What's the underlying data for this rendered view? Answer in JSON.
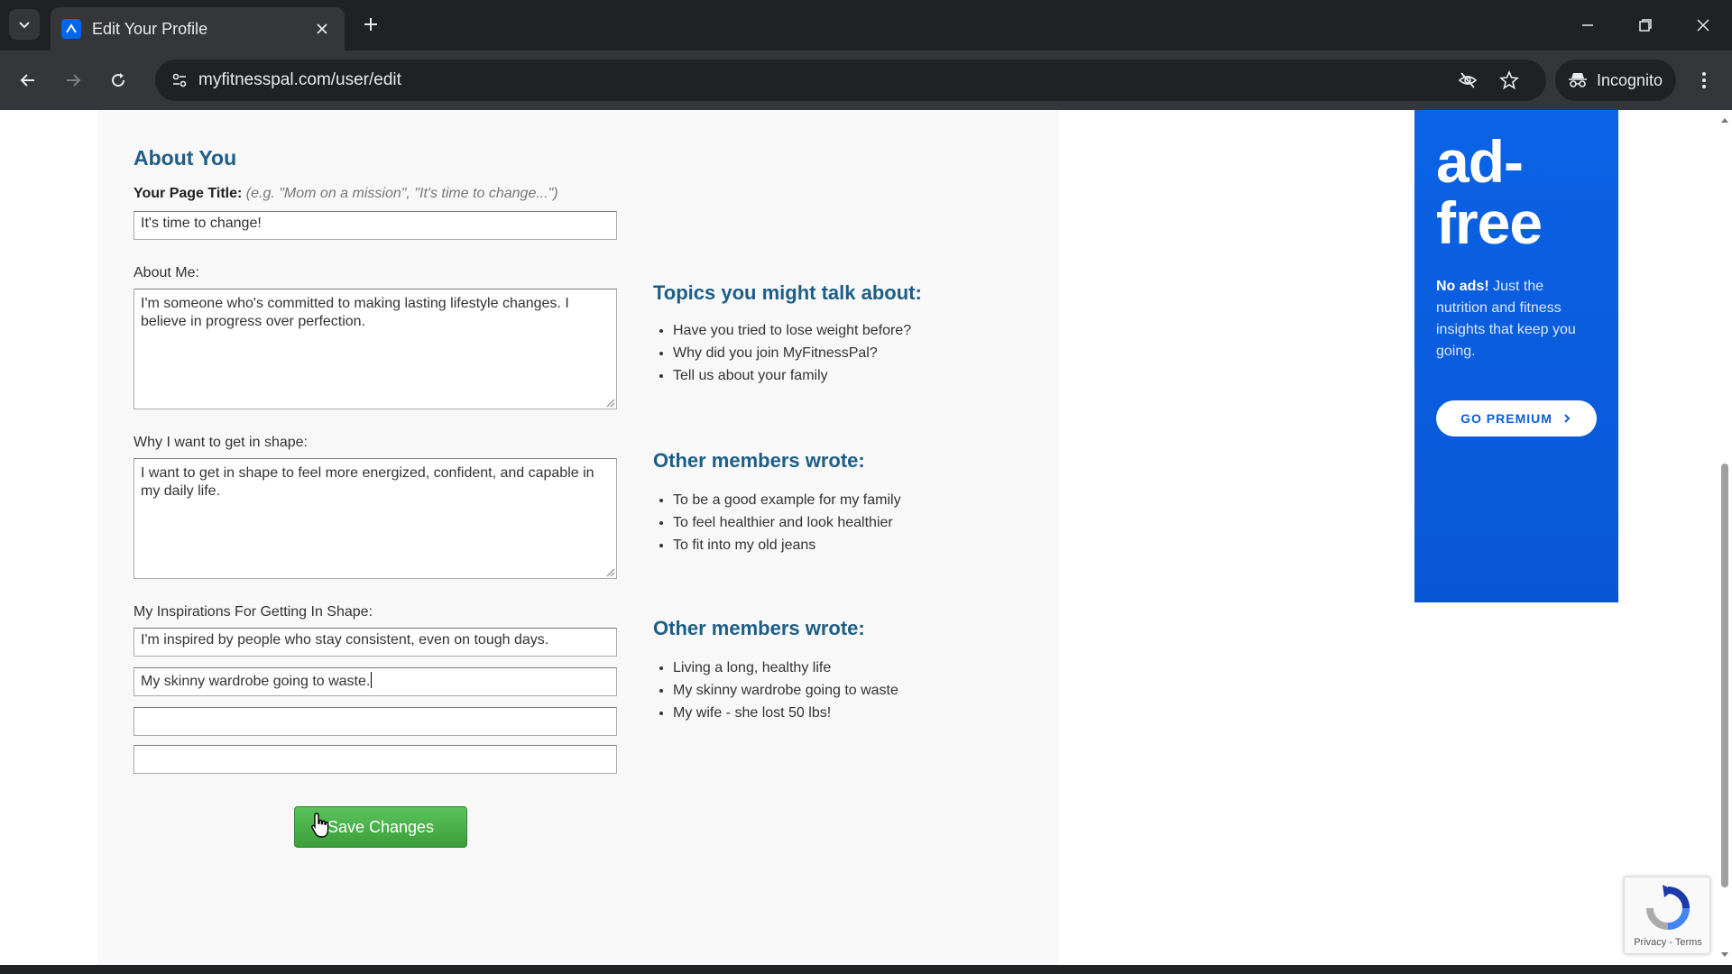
{
  "browser": {
    "tab_title": "Edit Your Profile",
    "url": "myfitnesspal.com/user/edit",
    "incognito_label": "Incognito"
  },
  "form": {
    "section_title": "About You",
    "page_title": {
      "label": "Your Page Title:",
      "hint": "(e.g. \"Mom on a mission\", \"It's time to change...\")",
      "value": "It's time to change!"
    },
    "about_me": {
      "label": "About Me:",
      "value": "I'm someone who's committed to making lasting lifestyle changes. I believe in progress over perfection."
    },
    "why_shape": {
      "label": "Why I want to get in shape:",
      "value": "I want to get in shape to feel more energized, confident, and capable in my daily life."
    },
    "inspirations": {
      "label": "My Inspirations For Getting In Shape:",
      "values": [
        "I'm inspired by people who stay consistent, even on tough days.",
        "My skinny wardrobe going to waste.",
        "",
        ""
      ]
    },
    "save_label": "Save Changes"
  },
  "suggestions": {
    "topics": {
      "heading": "Topics you might talk about:",
      "items": [
        "Have you tried to lose weight before?",
        "Why did you join MyFitnessPal?",
        "Tell us about your family"
      ]
    },
    "why_examples": {
      "heading": "Other members wrote:",
      "items": [
        "To be a good example for my family",
        "To feel healthier and look healthier",
        "To fit into my old jeans"
      ]
    },
    "inspiration_examples": {
      "heading": "Other members wrote:",
      "items": [
        "Living a long, healthy life",
        "My skinny wardrobe going to waste",
        "My wife - she lost 50 lbs!"
      ]
    }
  },
  "ad": {
    "headline_1": "ad-",
    "headline_2": "free",
    "body_bold": "No ads!",
    "body_rest": " Just the nutrition and fitness insights that keep you going.",
    "cta": "GO PREMIUM"
  },
  "recaptcha": {
    "links": "Privacy - Terms"
  },
  "colors": {
    "heading_blue": "#1d5e87",
    "ad_blue": "#0b63e5",
    "save_green": "#4cae4c"
  }
}
